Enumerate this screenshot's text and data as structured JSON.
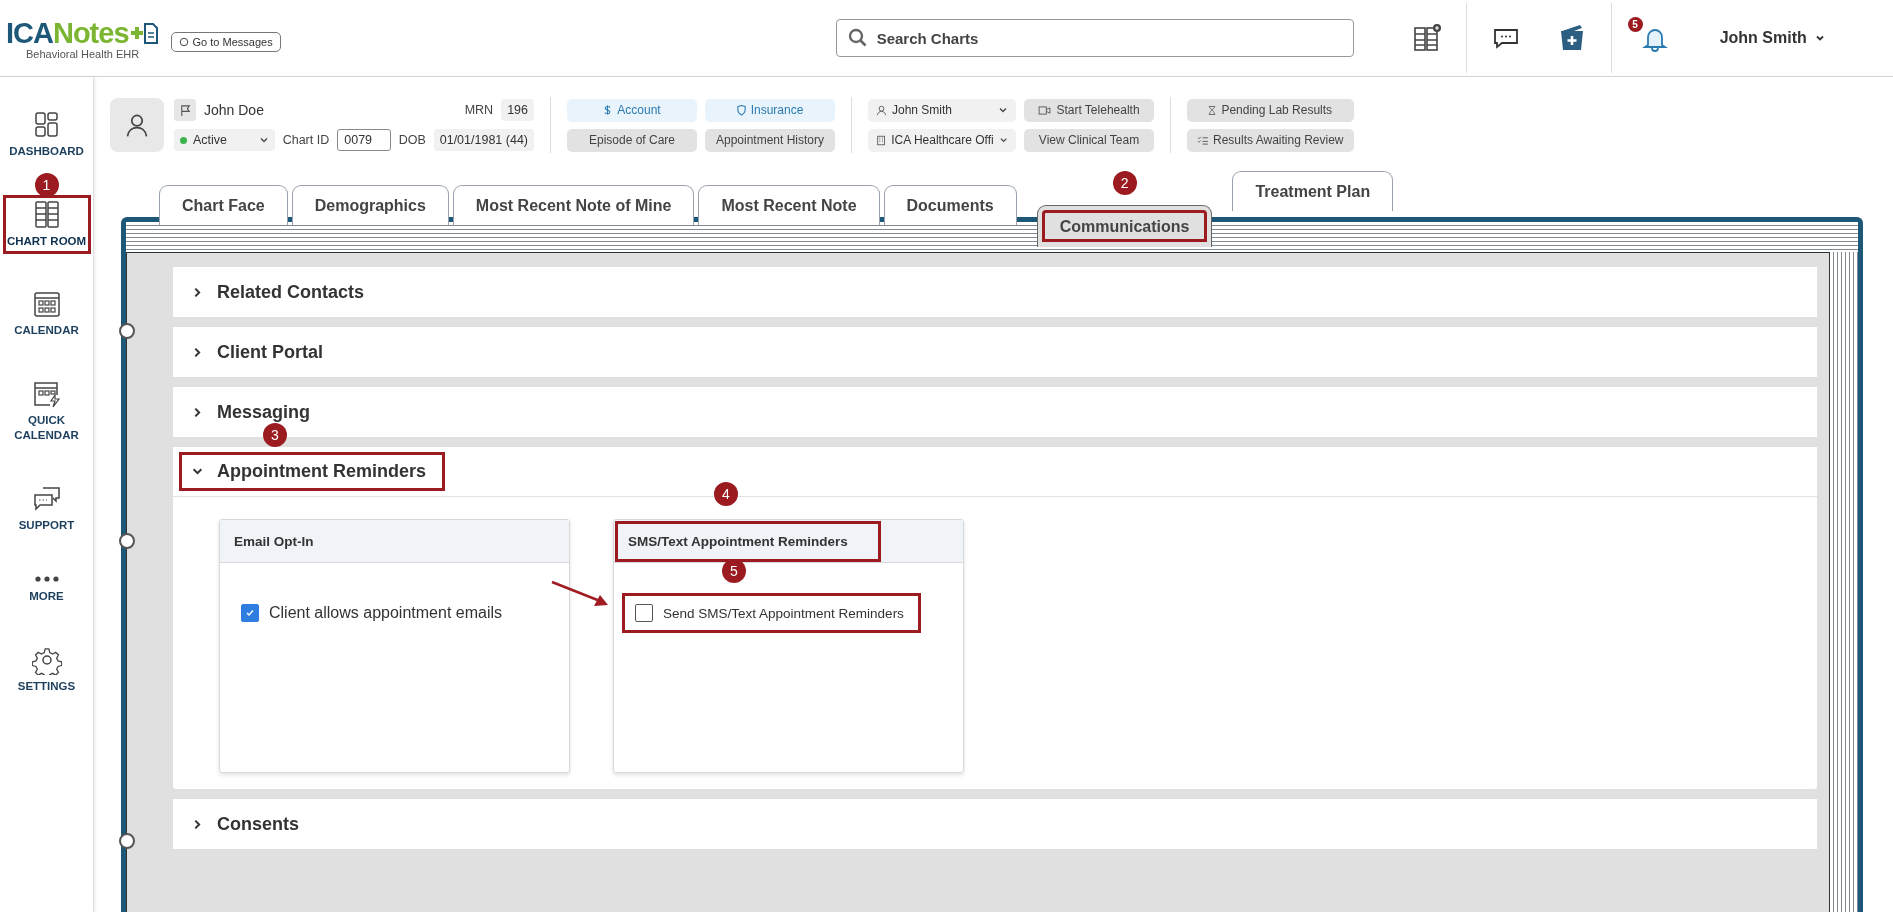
{
  "header": {
    "logo": {
      "brand_a": "ICA",
      "brand_b": "Notes",
      "tagline": "Behavioral Health EHR"
    },
    "messages_button": "Go to Messages",
    "search": {
      "placeholder": "Search Charts"
    },
    "notifications": {
      "count": "5"
    },
    "user": "John Smith"
  },
  "sidebar": {
    "items": [
      {
        "label": "DASHBOARD",
        "selected": false
      },
      {
        "label": "CHART ROOM",
        "selected": true,
        "callout": "1"
      },
      {
        "label": "CALENDAR",
        "selected": false
      },
      {
        "label": "QUICK CALENDAR",
        "selected": false
      },
      {
        "label": "SUPPORT",
        "selected": false
      },
      {
        "label": "MORE",
        "selected": false
      },
      {
        "label": "SETTINGS",
        "selected": false
      }
    ]
  },
  "patient": {
    "name": "John Doe",
    "status": "Active",
    "chart_id_label": "Chart ID",
    "chart_id": "0079",
    "mrn_label": "MRN",
    "mrn": "196",
    "dob_label": "DOB",
    "dob": "01/01/1981 (44)"
  },
  "actions": [
    {
      "label": "Account",
      "kind": "primary"
    },
    {
      "label": "Insurance",
      "kind": "primary"
    },
    {
      "label": "Episode of Care",
      "kind": "secondary"
    },
    {
      "label": "Appointment History",
      "kind": "secondary"
    }
  ],
  "assignments": [
    {
      "value": "John Smith"
    },
    {
      "value": "ICA Healthcare Offi"
    }
  ],
  "team_actions": [
    "Start Telehealth",
    "View Clinical Team"
  ],
  "lab_actions": [
    "Pending Lab Results",
    "Results Awaiting Review"
  ],
  "tabs": [
    {
      "label": "Chart Face",
      "selected": false
    },
    {
      "label": "Demographics",
      "selected": false
    },
    {
      "label": "Most Recent Note of Mine",
      "selected": false
    },
    {
      "label": "Most Recent Note",
      "selected": false
    },
    {
      "label": "Documents",
      "selected": false
    },
    {
      "label": "Communications",
      "selected": true,
      "callout": "2"
    },
    {
      "label": "Treatment Plan",
      "selected": false
    }
  ],
  "sections": [
    {
      "title": "Related Contacts",
      "expanded": false
    },
    {
      "title": "Client Portal",
      "expanded": false
    },
    {
      "title": "Messaging",
      "expanded": false
    },
    {
      "title": "Appointment Reminders",
      "expanded": true,
      "callout": "3",
      "cards": [
        {
          "title": "Email Opt-In",
          "option": {
            "label": "Client allows appointment emails",
            "checked": true
          }
        },
        {
          "title": "SMS/Text Appointment Reminders",
          "callout": "4",
          "option": {
            "label": "Send SMS/Text Appointment Reminders",
            "checked": false,
            "callout": "5",
            "arrow": true
          }
        }
      ]
    },
    {
      "title": "Consents",
      "expanded": false
    }
  ]
}
